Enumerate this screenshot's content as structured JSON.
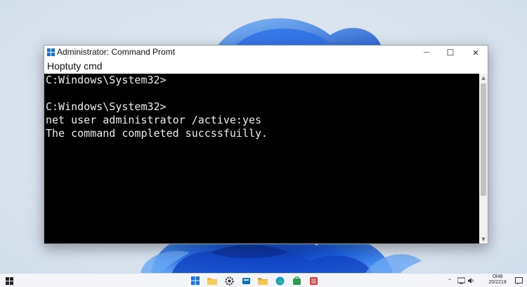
{
  "window": {
    "title": "Administrator: Command Promt",
    "menu_label": "Hoptuty cmd",
    "minimize_glyph": "—",
    "maximize_glyph": "☐",
    "close_glyph": "✕"
  },
  "console": {
    "lines": [
      "C:Windows\\System32>",
      "",
      "C:Windows\\System32>",
      "net user administrator /active:yes",
      "The command completed succssfuilly."
    ],
    "background": "#000000",
    "text_color": "#ececec"
  },
  "scrollbar": {
    "up_glyph": "▲",
    "down_glyph": "▼"
  },
  "taskbar": {
    "icons": [
      {
        "name": "start-icon"
      },
      {
        "name": "windows-icon"
      },
      {
        "name": "file-explorer-icon"
      },
      {
        "name": "settings-icon"
      },
      {
        "name": "edge-browser-icon"
      },
      {
        "name": "folder-icon"
      },
      {
        "name": "edge-icon"
      },
      {
        "name": "store-icon"
      },
      {
        "name": "mail-icon"
      },
      {
        "name": "app-grid-icon"
      },
      {
        "name": "chevron-up-icon"
      },
      {
        "name": "network-icon"
      },
      {
        "name": "volume-icon"
      },
      {
        "name": "notification-icon"
      }
    ],
    "time": "Ol48",
    "date": "20/2219"
  },
  "colors": {
    "accent": "#1a73d6",
    "wallpaper_bloom": "#1f5fd6",
    "taskbar": "#f3f5f8"
  }
}
